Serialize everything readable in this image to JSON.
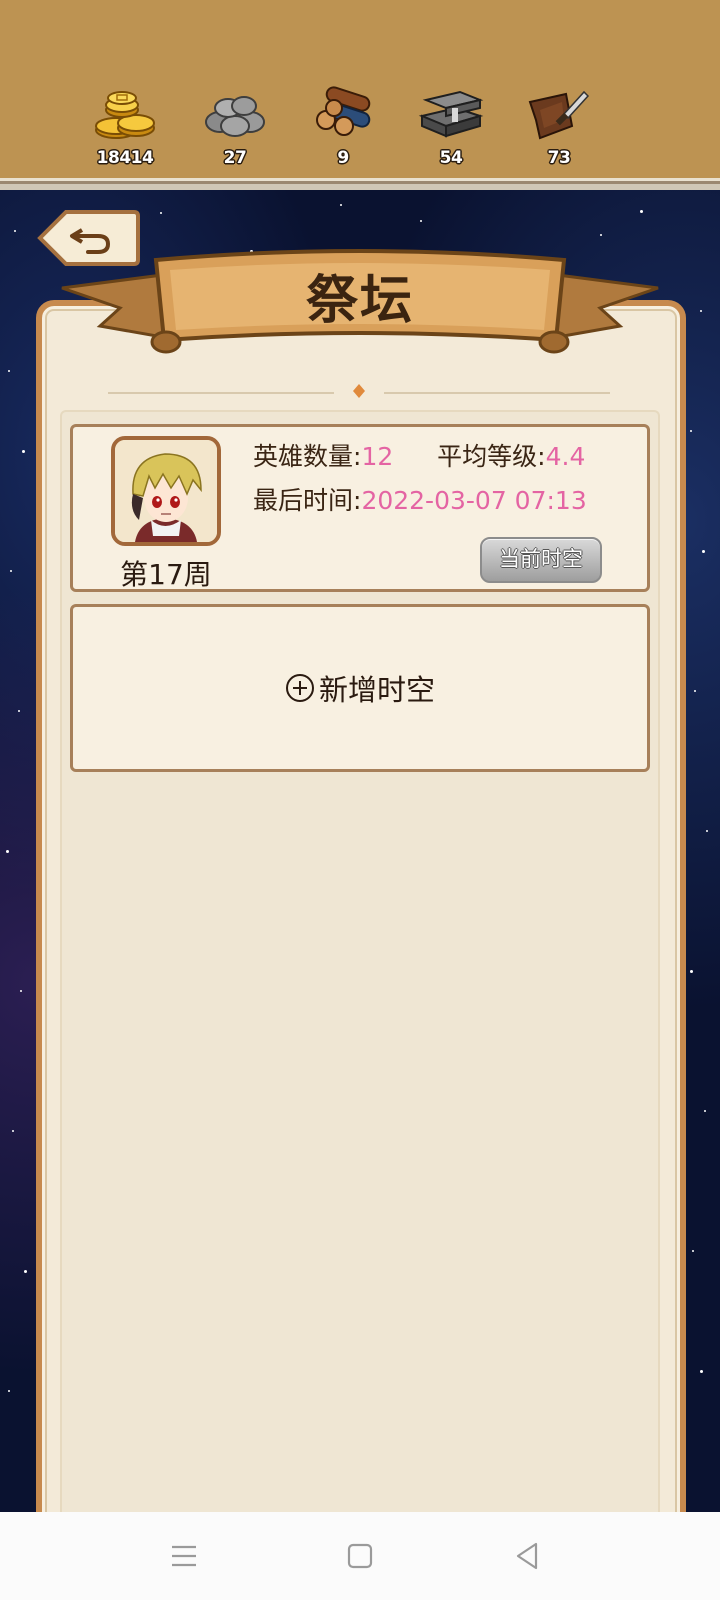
{
  "resources": [
    {
      "icon": "gold-coins-icon",
      "value": "18414"
    },
    {
      "icon": "stone-icon",
      "value": "27"
    },
    {
      "icon": "wood-logs-icon",
      "value": "9"
    },
    {
      "icon": "iron-ingot-icon",
      "value": "54"
    },
    {
      "icon": "leather-knife-icon",
      "value": "73"
    }
  ],
  "title": "祭坛",
  "timeline": {
    "week_label": "第17周",
    "hero_count_label": "英雄数量:",
    "hero_count_value": "12",
    "avg_level_label": "平均等级:",
    "avg_level_value": "4.4",
    "last_time_label": "最后时间:",
    "last_time_value": "2022-03-07 07:13",
    "current_button": "当前时空"
  },
  "add_timeline": {
    "label": "新增时空",
    "icon": "plus-circle-icon"
  },
  "nav": [
    "menu-icon",
    "home-square-icon",
    "back-triangle-icon"
  ],
  "colors": {
    "accent_value": "#e464a3",
    "topbar": "#bd9352",
    "panel_border": "#c78a4e"
  }
}
